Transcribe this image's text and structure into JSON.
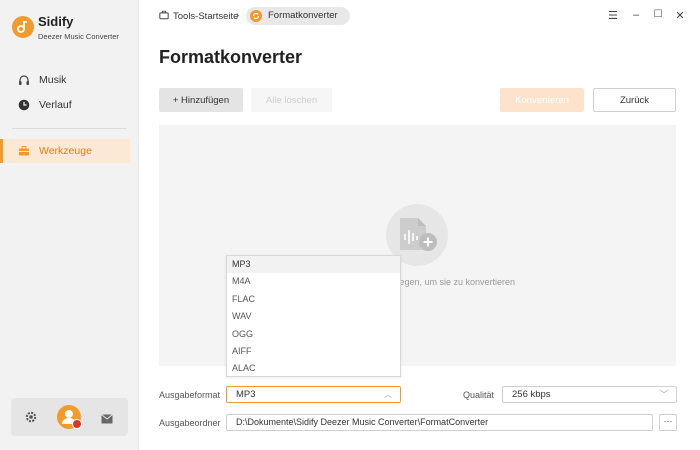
{
  "app": {
    "name": "Sidify",
    "subtitle": "Deezer Music Converter",
    "accent": "#f39a2c"
  },
  "sidebar": {
    "items": [
      {
        "label": "Musik",
        "icon": "headphones-icon",
        "active": false
      },
      {
        "label": "Verlauf",
        "icon": "clock-icon",
        "active": false
      },
      {
        "label": "Werkzeuge",
        "icon": "toolbox-icon",
        "active": true
      }
    ],
    "footer": {
      "icons": [
        "gear-icon",
        "avatar",
        "mail-icon"
      ]
    }
  },
  "breadcrumb": {
    "home": "Tools-Startseite",
    "separator": "›",
    "current": "Formatkonverter"
  },
  "window_controls": {
    "menu": "☰",
    "minimize": "–",
    "maximize": "☐",
    "close": "✕"
  },
  "page": {
    "title": "Formatkonverter"
  },
  "toolbar": {
    "add_label": "+ Hinzufügen",
    "clear_label": "Alle löschen",
    "convert_label": "Konvertieren",
    "back_label": "Zurück"
  },
  "dropzone": {
    "hint": "d ablegen, um sie zu konvertieren"
  },
  "format_dropdown": {
    "options": [
      "MP3",
      "M4A",
      "FLAC",
      "WAV",
      "OGG",
      "AIFF",
      "ALAC"
    ],
    "selected": "MP3"
  },
  "output": {
    "format_label": "Ausgabeformat",
    "format_value": "MP3",
    "quality_label": "Qualität",
    "quality_value": "256 kbps",
    "folder_label": "Ausgabeordner",
    "folder_value": "D:\\Dokumente\\Sidify Deezer Music Converter\\FormatConverter",
    "browse_label": "···"
  }
}
